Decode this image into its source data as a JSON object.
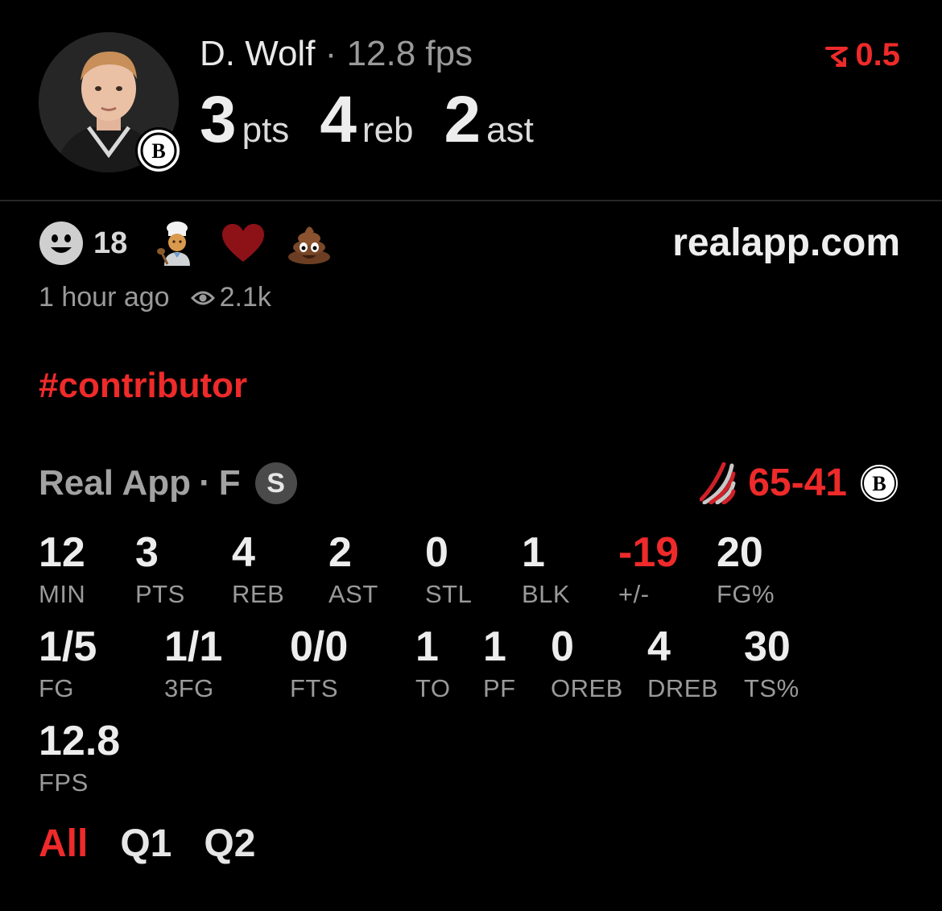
{
  "player": {
    "name": "D. Wolf",
    "separator": "·",
    "fps_label": "12.8 fps",
    "pts_value": "3",
    "pts_label": "pts",
    "reb_value": "4",
    "reb_label": "reb",
    "ast_value": "2",
    "ast_label": "ast",
    "team_badge_letter": "B"
  },
  "delta": {
    "value": "0.5",
    "color": "#ee2a2a",
    "icon": "trend-down-icon"
  },
  "reactions": {
    "count": "18",
    "site": "realapp.com",
    "icons": [
      "smiley-icon",
      "cook-emoji",
      "heart-emoji",
      "poop-emoji"
    ]
  },
  "meta": {
    "time_ago": "1 hour ago",
    "views": "2.1k"
  },
  "hashtag": "#contributor",
  "game": {
    "source": "Real App",
    "separator": "·",
    "status": "F",
    "badge": "S",
    "score": "65-41",
    "home_badge_letter": "B"
  },
  "stats_row1": [
    {
      "value": "12",
      "label": "MIN"
    },
    {
      "value": "3",
      "label": "PTS"
    },
    {
      "value": "4",
      "label": "REB"
    },
    {
      "value": "2",
      "label": "AST"
    },
    {
      "value": "0",
      "label": "STL"
    },
    {
      "value": "1",
      "label": "BLK"
    },
    {
      "value": "-19",
      "label": "+/-"
    },
    {
      "value": "20",
      "label": "FG%"
    }
  ],
  "stats_row2": [
    {
      "value": "1/5",
      "label": "FG"
    },
    {
      "value": "1/1",
      "label": "3FG"
    },
    {
      "value": "0/0",
      "label": "FTS"
    },
    {
      "value": "1",
      "label": "TO"
    },
    {
      "value": "1",
      "label": "PF"
    },
    {
      "value": "0",
      "label": "OREB"
    },
    {
      "value": "4",
      "label": "DREB"
    },
    {
      "value": "30",
      "label": "TS%"
    }
  ],
  "stats_row3": [
    {
      "value": "12.8",
      "label": "FPS"
    }
  ],
  "tabs": [
    {
      "label": "All",
      "active": true
    },
    {
      "label": "Q1",
      "active": false
    },
    {
      "label": "Q2",
      "active": false
    }
  ],
  "colors": {
    "accent": "#ee2a2a",
    "background": "#000000",
    "muted": "#9a9a9a"
  }
}
